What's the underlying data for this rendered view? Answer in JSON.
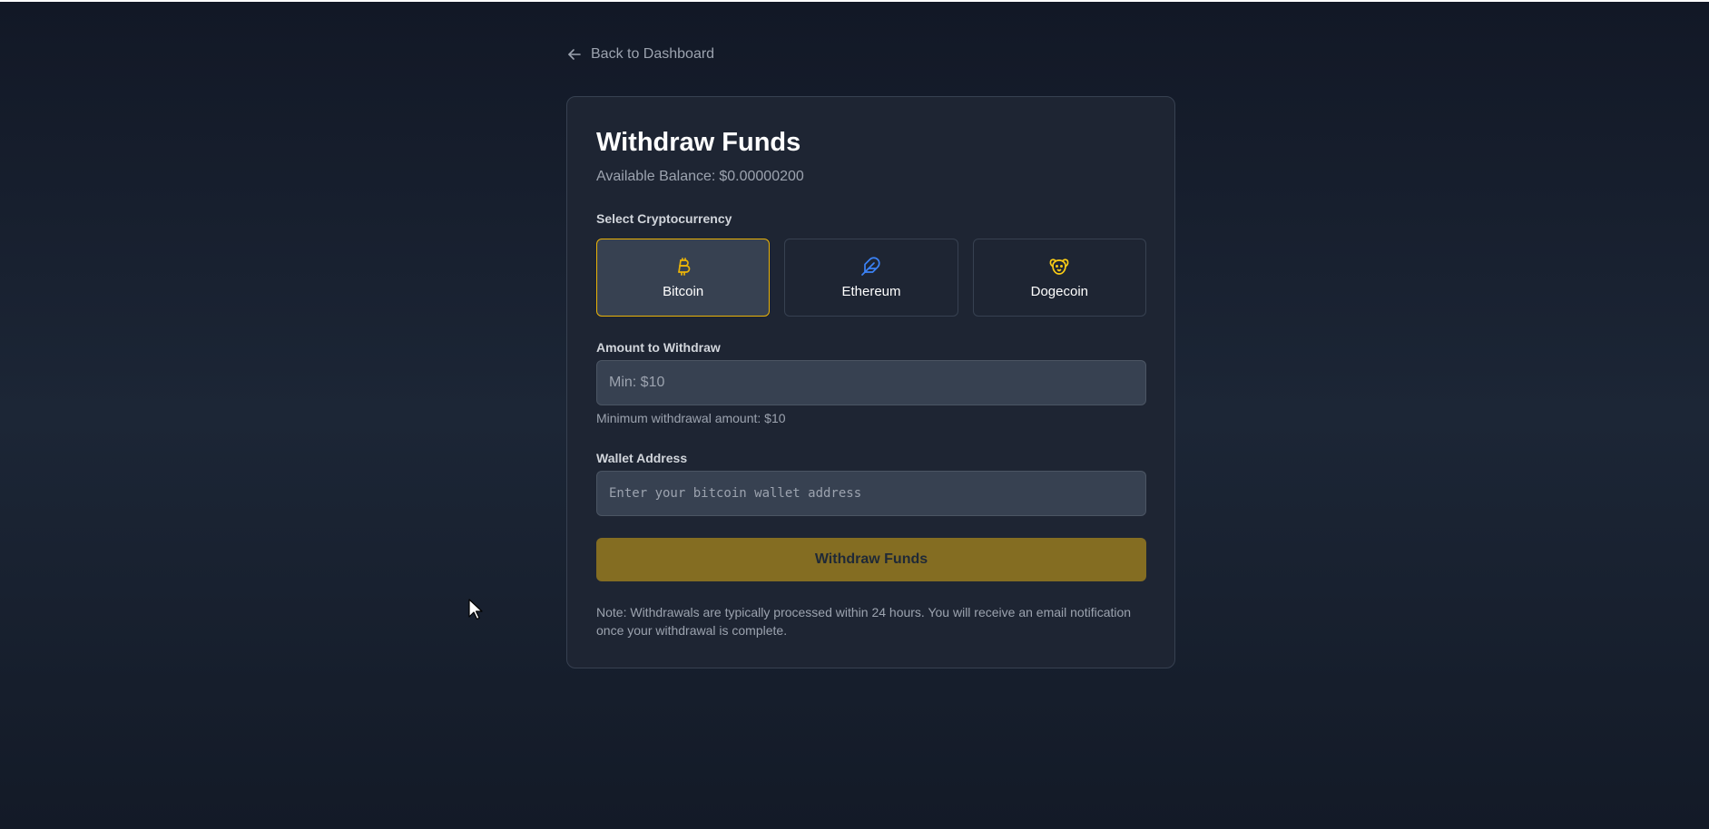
{
  "nav": {
    "back_label": "Back to Dashboard"
  },
  "withdraw": {
    "title": "Withdraw Funds",
    "balance_label": "Available Balance:",
    "balance_value": "$0.00000200",
    "crypto_label": "Select Cryptocurrency",
    "cryptos": [
      {
        "name": "Bitcoin",
        "icon": "bitcoin-icon",
        "color": "#eab308",
        "selected": true
      },
      {
        "name": "Ethereum",
        "icon": "feather-icon",
        "color": "#3b82f6",
        "selected": false
      },
      {
        "name": "Dogecoin",
        "icon": "dog-icon",
        "color": "#facc15",
        "selected": false
      }
    ],
    "amount_label": "Amount to Withdraw",
    "amount_placeholder": "Min: $10",
    "amount_value": "",
    "min_hint": "Minimum withdrawal amount: $10",
    "wallet_label": "Wallet Address",
    "wallet_placeholder": "Enter your bitcoin wallet address",
    "wallet_value": "",
    "submit_label": "Withdraw Funds",
    "note": "Note: Withdrawals are typically processed within 24 hours. You will receive an email notification once your withdrawal is complete."
  },
  "colors": {
    "accent": "#eab308",
    "button_bg": "#846d22",
    "card_bg": "#1e2533",
    "page_bg": "#151c2a"
  }
}
